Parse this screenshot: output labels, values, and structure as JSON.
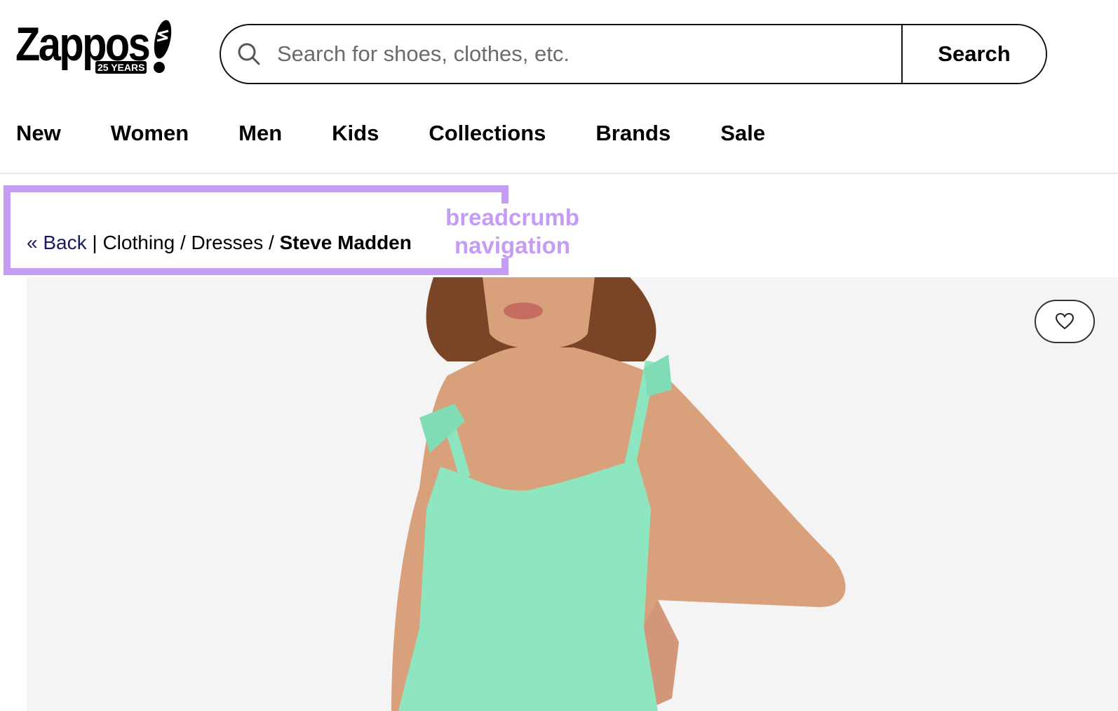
{
  "logo": {
    "wordmark": "Zappos",
    "badge": "25 YEARS"
  },
  "search": {
    "placeholder": "Search for shoes, clothes, etc.",
    "value": "",
    "button_label": "Search"
  },
  "nav": {
    "items": [
      "New",
      "Women",
      "Men",
      "Kids",
      "Collections",
      "Brands",
      "Sale"
    ]
  },
  "breadcrumb": {
    "back": "« Back",
    "separator": "|",
    "items": [
      "Clothing",
      "Dresses"
    ],
    "slash": "/",
    "current": "Steve Madden"
  },
  "annotation": {
    "line1": "breadcrumb",
    "line2": "navigation",
    "color": "#c59cf3"
  },
  "product": {
    "dress_color": "#8ee6c1",
    "favorite_icon": "heart-icon"
  }
}
